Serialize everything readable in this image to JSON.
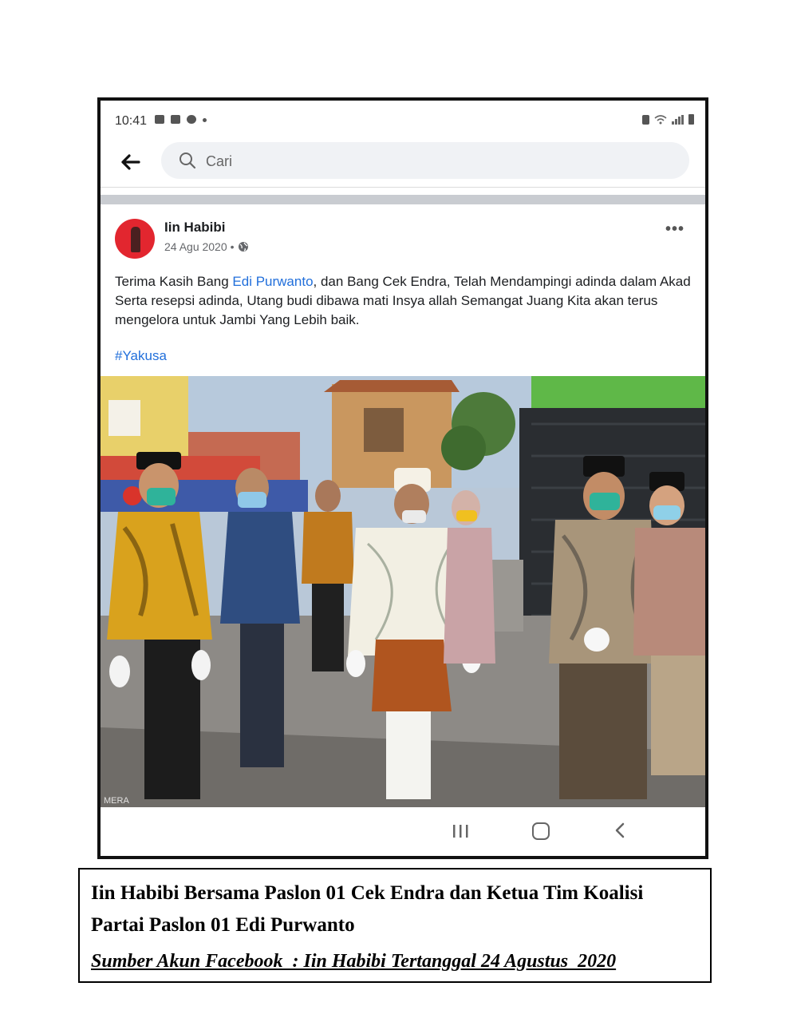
{
  "status_bar": {
    "time": "10:41"
  },
  "search": {
    "placeholder": "Cari"
  },
  "post": {
    "author": "Iin Habibi",
    "date": "24 Agu 2020",
    "separator": "•",
    "more": "•••",
    "text_before": "Terima Kasih Bang ",
    "mention": "Edi Purwanto",
    "text_after": ", dan Bang Cek Endra, Telah Mendampingi adinda dalam Akad Serta resepsi adinda, Utang budi dibawa mati Insya allah Semangat Juang Kita akan terus mengelora untuk Jambi Yang Lebih baik.",
    "hashtag": "#Yakusa",
    "photo_watermark": "MERA"
  },
  "caption": {
    "title": "Iin Habibi Bersama Paslon 01 Cek Endra dan Ketua Tim Koalisi Partai Paslon 01 Edi Purwanto",
    "source": "Sumber Akun Facebook  : Iin Habibi Tertanggal 24 Agustus  2020"
  },
  "icons": {
    "back": "arrow-left-icon",
    "search": "search-icon",
    "globe": "globe-icon",
    "more": "more-icon"
  }
}
